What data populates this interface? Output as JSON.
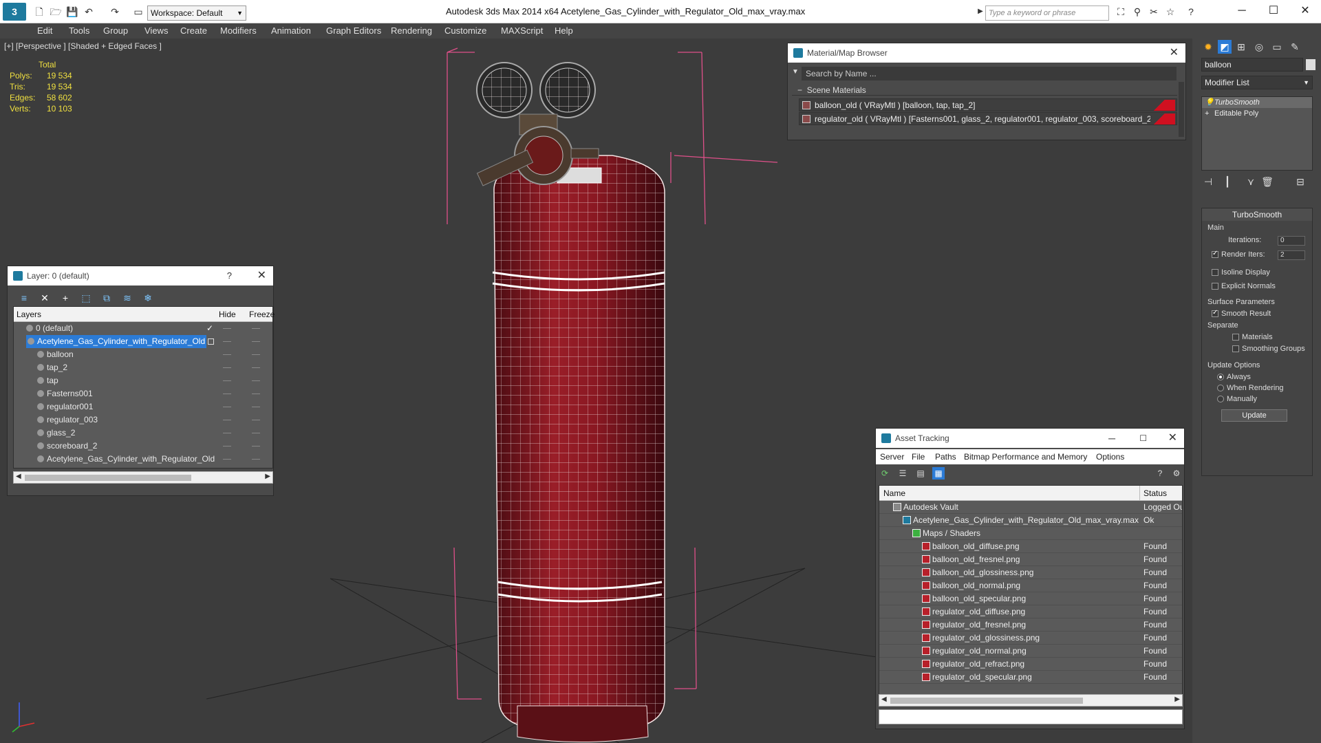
{
  "app": {
    "title": "Autodesk 3ds Max  2014 x64      Acetylene_Gas_Cylinder_with_Regulator_Old_max_vray.max",
    "workspace": "Workspace: Default",
    "search_placeholder": "Type a keyword or phrase"
  },
  "menu": [
    "Edit",
    "Tools",
    "Group",
    "Views",
    "Create",
    "Modifiers",
    "Animation",
    "Graph Editors",
    "Rendering",
    "Customize",
    "MAXScript",
    "Help"
  ],
  "viewport": {
    "label": "[+] [Perspective ] [Shaded + Edged Faces ]",
    "stats": {
      "header": "Total",
      "rows": [
        {
          "k": "Polys:",
          "v": "19 534"
        },
        {
          "k": "Tris:",
          "v": "19 534"
        },
        {
          "k": "Edges:",
          "v": "58 602"
        },
        {
          "k": "Verts:",
          "v": "10 103"
        }
      ]
    }
  },
  "layer_panel": {
    "title": "Layer: 0 (default)",
    "help": "?",
    "columns": {
      "layers": "Layers",
      "hide": "Hide",
      "freeze": "Freeze"
    },
    "rows": [
      {
        "name": "0 (default)",
        "indent": 0
      },
      {
        "name": "Acetylene_Gas_Cylinder_with_Regulator_Old",
        "indent": 0,
        "selected": true
      },
      {
        "name": "balloon",
        "indent": 1
      },
      {
        "name": "tap_2",
        "indent": 1
      },
      {
        "name": "tap",
        "indent": 1
      },
      {
        "name": "Fasterns001",
        "indent": 1
      },
      {
        "name": "regulator001",
        "indent": 1
      },
      {
        "name": "regulator_003",
        "indent": 1
      },
      {
        "name": "glass_2",
        "indent": 1
      },
      {
        "name": "scoreboard_2",
        "indent": 1
      },
      {
        "name": "Acetylene_Gas_Cylinder_with_Regulator_Old",
        "indent": 1
      }
    ]
  },
  "material_browser": {
    "title": "Material/Map Browser",
    "search_placeholder": "Search by Name ...",
    "section": "Scene Materials",
    "items": [
      "balloon_old  ( VRayMtl )  [balloon, tap, tap_2]",
      "regulator_old  ( VRayMtl ) [Fasterns001, glass_2, regulator001, regulator_003, scoreboard_2]"
    ]
  },
  "asset_tracking": {
    "title": "Asset Tracking",
    "menu": [
      "Server",
      "File",
      "Paths",
      "Bitmap Performance and Memory",
      "Options"
    ],
    "columns": {
      "name": "Name",
      "status": "Status"
    },
    "rows": [
      {
        "name": "Autodesk Vault",
        "status": "Logged Ou",
        "indent": 1,
        "kind": "vault"
      },
      {
        "name": "Acetylene_Gas_Cylinder_with_Regulator_Old_max_vray.max",
        "status": "Ok",
        "indent": 2,
        "kind": "max"
      },
      {
        "name": "Maps / Shaders",
        "status": "",
        "indent": 3,
        "kind": "folder"
      },
      {
        "name": "balloon_old_diffuse.png",
        "status": "Found",
        "indent": 4,
        "kind": "png"
      },
      {
        "name": "balloon_old_fresnel.png",
        "status": "Found",
        "indent": 4,
        "kind": "png"
      },
      {
        "name": "balloon_old_glossiness.png",
        "status": "Found",
        "indent": 4,
        "kind": "png"
      },
      {
        "name": "balloon_old_normal.png",
        "status": "Found",
        "indent": 4,
        "kind": "png"
      },
      {
        "name": "balloon_old_specular.png",
        "status": "Found",
        "indent": 4,
        "kind": "png"
      },
      {
        "name": "regulator_old_diffuse.png",
        "status": "Found",
        "indent": 4,
        "kind": "png"
      },
      {
        "name": "regulator_old_fresnel.png",
        "status": "Found",
        "indent": 4,
        "kind": "png"
      },
      {
        "name": "regulator_old_glossiness.png",
        "status": "Found",
        "indent": 4,
        "kind": "png"
      },
      {
        "name": "regulator_old_normal.png",
        "status": "Found",
        "indent": 4,
        "kind": "png"
      },
      {
        "name": "regulator_old_refract.png",
        "status": "Found",
        "indent": 4,
        "kind": "png"
      },
      {
        "name": "regulator_old_specular.png",
        "status": "Found",
        "indent": 4,
        "kind": "png"
      }
    ]
  },
  "command_panel": {
    "object_name": "balloon",
    "modifier_list": "Modifier List",
    "stack": [
      "TurboSmooth",
      "Editable Poly"
    ],
    "turbosmooth": {
      "header": "TurboSmooth",
      "main": "Main",
      "iterations_label": "Iterations:",
      "iterations": "0",
      "render_iters_label": "Render Iters:",
      "render_iters": "2",
      "isoline": "Isoline Display",
      "explicit_normals": "Explicit Normals",
      "surface_params": "Surface Parameters",
      "smooth_result": "Smooth Result",
      "separate": "Separate",
      "materials": "Materials",
      "smoothing_groups": "Smoothing Groups",
      "update_options": "Update Options",
      "always": "Always",
      "when_rendering": "When Rendering",
      "manually": "Manually",
      "update_button": "Update"
    }
  },
  "colors": {
    "cylinder_red": "#8e1a22",
    "selection_blue": "#2b7bd6",
    "stats_yellow": "#f0e040",
    "bbox_pink": "#e0508a"
  }
}
